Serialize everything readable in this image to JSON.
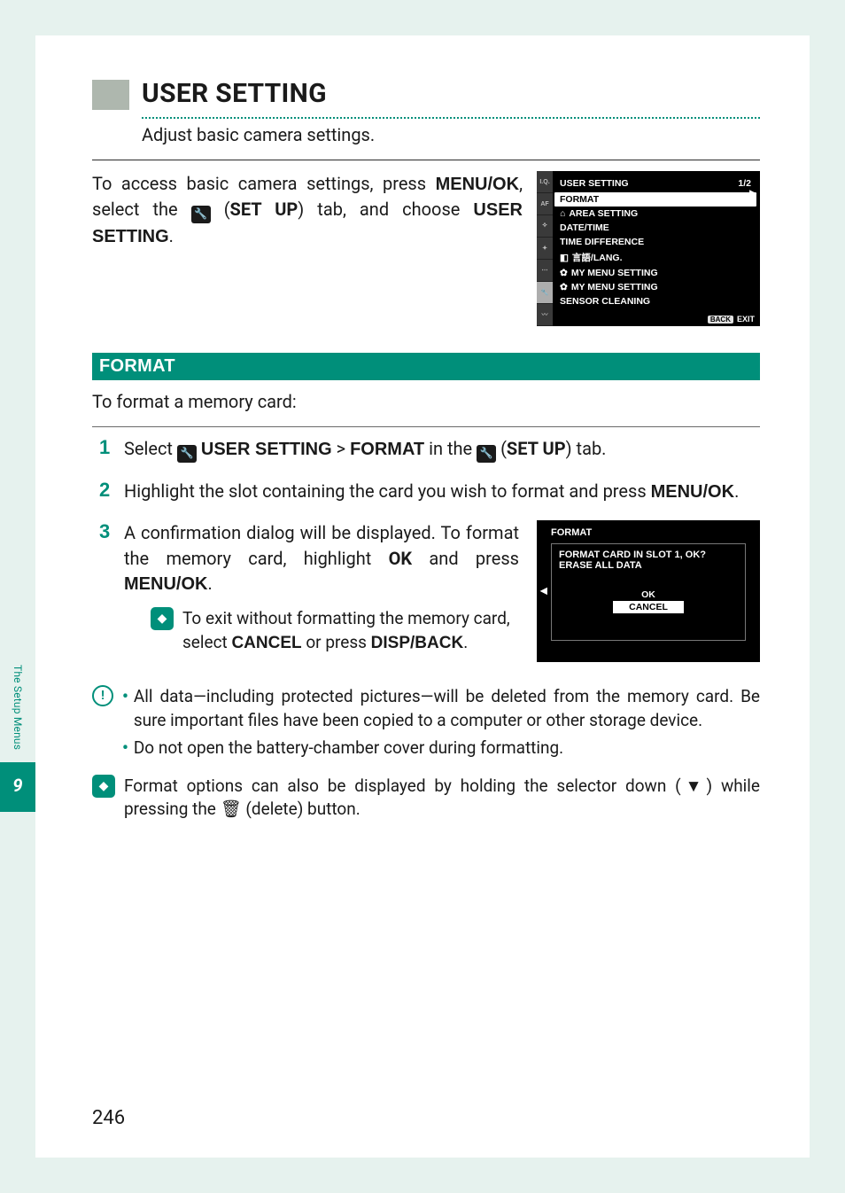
{
  "sidebar": {
    "label": "The Setup Menus",
    "chapter_number": "9"
  },
  "heading": {
    "title": "USER SETTING",
    "subtitle": "Adjust basic camera settings."
  },
  "access": {
    "p1": "To access basic camera settings, press ",
    "menuok": "MENU/OK",
    "p2": ", select the ",
    "setup": "SET UP",
    "p3": ") tab, and choose ",
    "usersetting": "USER SETTING",
    "p4": "."
  },
  "cam_menu": {
    "title": "USER SETTING",
    "page": "1/2",
    "items": [
      "FORMAT",
      "AREA SETTING",
      "DATE/TIME",
      "TIME DIFFERENCE",
      "言語/LANG.",
      "MY MENU SETTING",
      "MY MENU SETTING",
      "SENSOR CLEANING"
    ],
    "back_label": "BACK",
    "exit": "EXIT"
  },
  "section": {
    "title": "FORMAT"
  },
  "format_intro": "To format a memory card:",
  "step1": {
    "a": "Select ",
    "us": "USER SETTING",
    "gt": " > ",
    "fmt": "FORMAT",
    "b": " in the ",
    "setup": "SET UP",
    "c": ") tab."
  },
  "step2": {
    "a": "Highlight the slot containing the card you wish to format and press ",
    "menuok": "MENU/OK",
    "b": "."
  },
  "step3": {
    "a": "A confirmation dialog will be displayed. To format the memory card, highlight ",
    "ok": "OK",
    "b": " and press ",
    "menuok": "MENU/OK",
    "c": "."
  },
  "tip1": {
    "a": "To exit without formatting the memory card, select ",
    "cancel": "CANCEL",
    "b": " or press ",
    "dispback": "DISP/BACK",
    "c": "."
  },
  "dlg": {
    "title": "FORMAT",
    "line1": "FORMAT CARD IN SLOT 1, OK?",
    "line2": "ERASE ALL DATA",
    "ok": "OK",
    "cancel": "CANCEL"
  },
  "warn": {
    "b1": "All data—including protected pictures—will be deleted from the memory card. Be sure important files have been copied to a computer or other storage device.",
    "b2": "Do not open the battery-chamber cover during formatting."
  },
  "tip2": {
    "a": "Format options can also be displayed by holding the selector down (",
    "down": "▼",
    "b": ") while pressing the ",
    "c": " (delete) button."
  },
  "page_number": "246"
}
